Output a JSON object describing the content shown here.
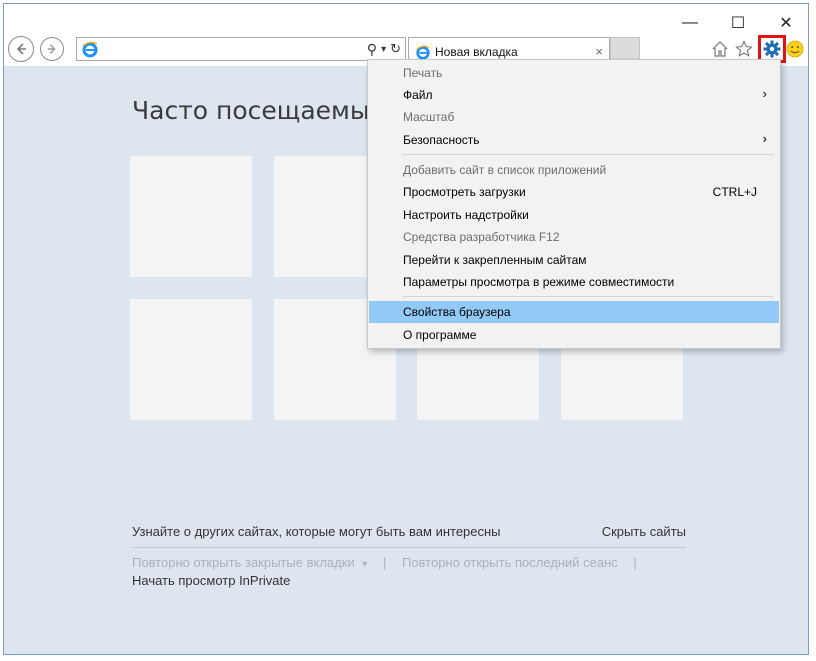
{
  "window": {
    "controls": {
      "minimize": "—",
      "maximize": "☐",
      "close": "✕"
    }
  },
  "toolbar": {
    "back_icon": "back-arrow-icon",
    "forward_icon": "forward-arrow-icon",
    "address_value": "",
    "search_glyph": "⚲",
    "dropdown_glyph": "▾",
    "refresh_glyph": "↻",
    "home_icon": "home-icon",
    "favorites_icon": "star-icon",
    "tools_icon": "gear-icon",
    "feedback_icon": "smiley-icon"
  },
  "tab": {
    "title": "Новая вкладка",
    "close": "×"
  },
  "page": {
    "heading": "Часто посещаемые",
    "discover": "Узнайте о других сайтах, которые могут быть вам интересны",
    "hide_sites": "Скрыть сайты",
    "reopen_tabs": "Повторно открыть закрытые вкладки",
    "reopen_caret": "▾",
    "divider": "|",
    "reopen_session": "Повторно открыть последний сеанс",
    "inprivate": "Начать просмотр InPrivate"
  },
  "menu": {
    "print": "Печать",
    "file": "Файл",
    "zoom": "Масштаб",
    "safety": "Безопасность",
    "add_site": "Добавить сайт в список приложений",
    "downloads": "Просмотреть загрузки",
    "downloads_shortcut": "CTRL+J",
    "addons": "Настроить надстройки",
    "devtools": "Средства разработчика F12",
    "pinned": "Перейти к закрепленным сайтам",
    "compat": "Параметры просмотра в режиме совместимости",
    "options": "Свойства браузера",
    "about": "О программе",
    "arrow": "›"
  },
  "colors": {
    "content_bg": "#dde6ef",
    "menu_highlight": "#91c9f7",
    "gear_border": "#e51414",
    "ie_blue": "#1e90ff"
  }
}
